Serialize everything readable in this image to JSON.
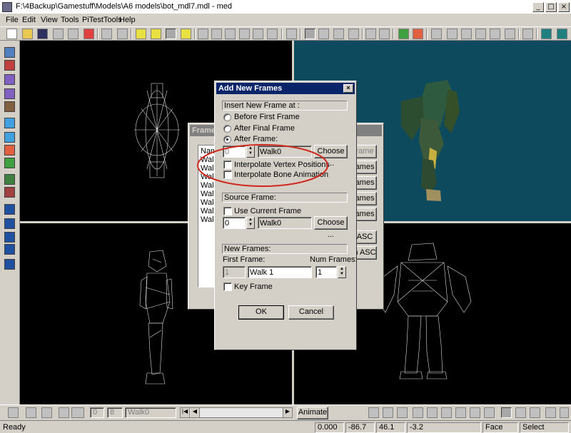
{
  "window": {
    "title": "F:\\4Backup\\Gamestuff\\Models\\A6 models\\bot_mdl7.mdl - med",
    "minimize": "_",
    "maximize": "□",
    "close": "×"
  },
  "menu": [
    "File",
    "Edit",
    "View",
    "Tools",
    "PiTestTools",
    "Help"
  ],
  "colors": {
    "viewport_bg": "#000000",
    "perspective_bg": "#0e4a5e",
    "accent": "#0a246a",
    "highlight_ellipse": "#d0281c"
  },
  "frames_dialog": {
    "title": "Frames",
    "list_header": "Nam",
    "items": [
      "Walk",
      "Walk",
      "Walk",
      "Walk",
      "Walk",
      "Walk",
      "Walk",
      "Walk"
    ],
    "side_buttons": [
      "rame",
      "ames",
      "ames",
      "ames",
      "ames",
      "ASC",
      "n ASC"
    ]
  },
  "add_frames": {
    "title": "Add New Frames",
    "close": "×",
    "insert_group": "Insert New Frame at :",
    "opt_before": "Before First Frame",
    "opt_after_final": "After Final Frame",
    "opt_after": "After Frame:",
    "after_value": "0",
    "after_name": "Walk0",
    "choose": "Choose ...",
    "interp_vertex": "Interpolate Vertex Positions",
    "interp_bone": "Interpolate Bone Animation",
    "source_group": "Source Frame:",
    "use_current": "Use Current Frame",
    "source_value": "0",
    "source_name": "Walk0",
    "choose2": "Choose ...",
    "new_group": "New Frames:",
    "first_frame_label": "First Frame:",
    "num_frames_label": "Num Frames:",
    "first_index": "1",
    "first_name": "Walk 1",
    "num_frames": "1",
    "key_frame": "Key Frame",
    "ok": "OK",
    "cancel": "Cancel"
  },
  "timeline": {
    "frame_from": "0",
    "frame_to": "8",
    "frame_name": "Walk0",
    "animate": "Animate"
  },
  "status": {
    "ready": "Ready",
    "x": "0.000",
    "y": "-86.7",
    "z": "46.1",
    "w": "-3.2",
    "mode": "Face",
    "tool": "Select"
  }
}
